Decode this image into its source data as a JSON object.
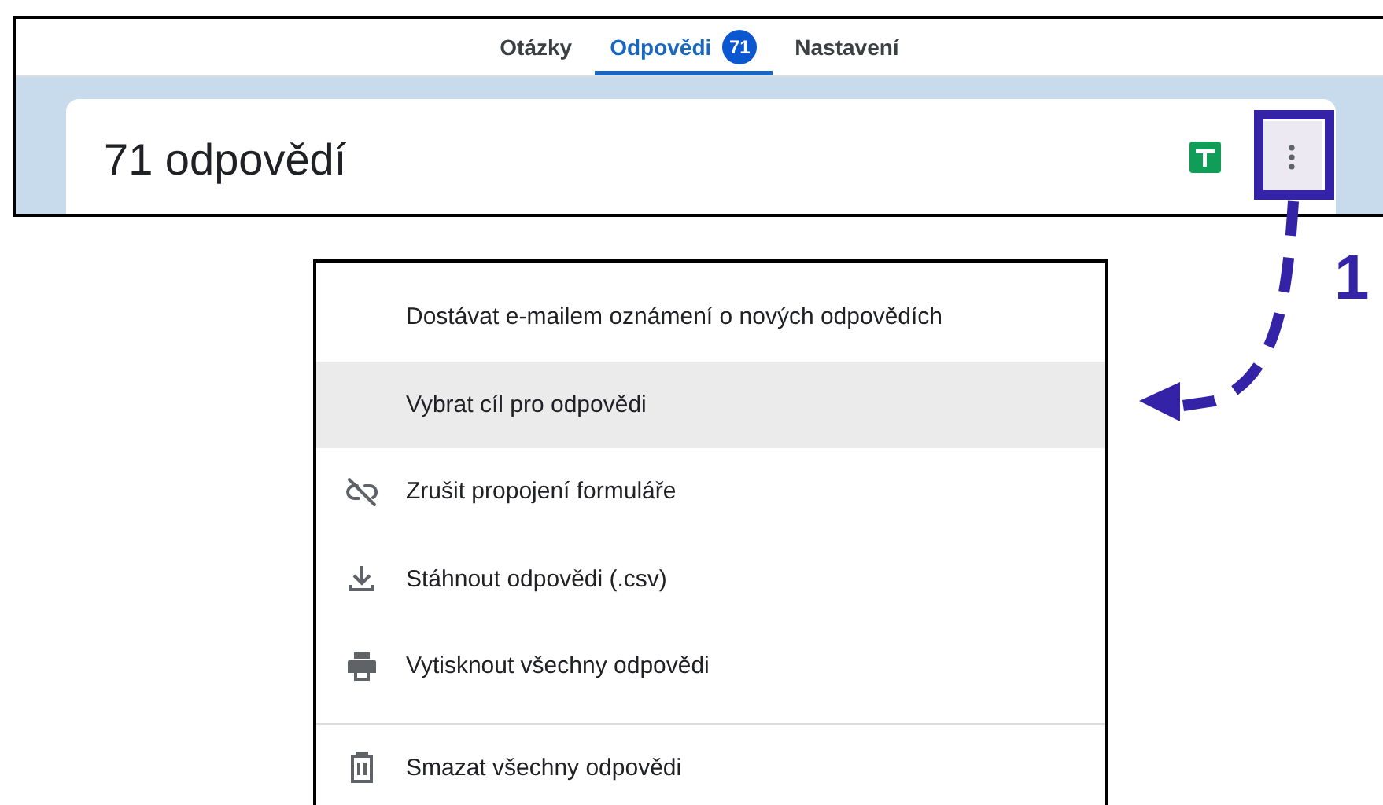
{
  "tabs": [
    {
      "label": "Otázky",
      "selected": false
    },
    {
      "label": "Odpovědi",
      "selected": true,
      "badge": "71"
    },
    {
      "label": "Nastavení",
      "selected": false
    }
  ],
  "card": {
    "title": "71 odpovědí"
  },
  "menu": {
    "items": [
      {
        "label": "Dostávat e-mailem oznámení o nových odpovědích",
        "kind": "plain",
        "selected": false,
        "divider_before": false
      },
      {
        "label": "Vybrat cíl pro odpovědi",
        "kind": "plain",
        "selected": true,
        "divider_before": false
      },
      {
        "label": "Zrušit propojení formuláře",
        "kind": "unlink",
        "selected": false,
        "divider_before": false
      },
      {
        "label": "Stáhnout odpovědi (.csv)",
        "kind": "download",
        "selected": false,
        "divider_before": false
      },
      {
        "label": "Vytisknout všechny odpovědi",
        "kind": "print",
        "selected": false,
        "divider_before": false
      },
      {
        "label": "Smazat všechny odpovědi",
        "kind": "trash",
        "selected": false,
        "divider_before": true
      }
    ]
  },
  "annotation": {
    "step_label": "1"
  }
}
